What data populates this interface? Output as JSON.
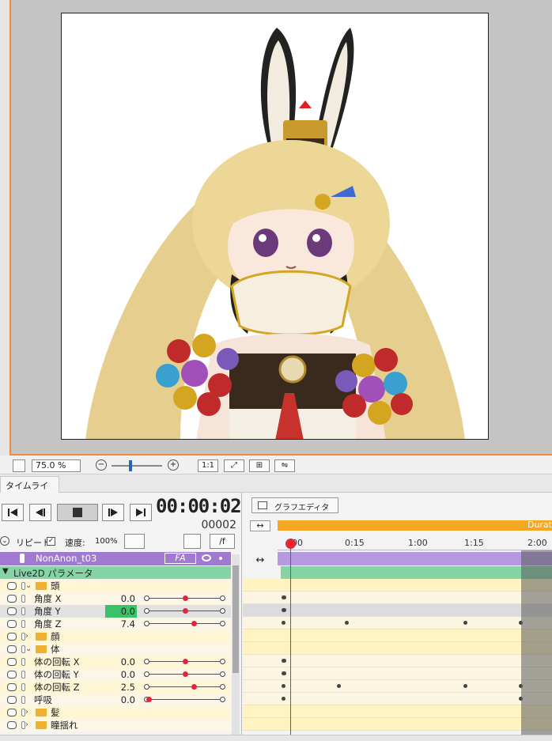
{
  "zoom": {
    "value": "75.0",
    "unit": "%",
    "ratio_button": "1:1"
  },
  "timeline": {
    "tab_label": "タイムライン",
    "timecode": "00:00:02",
    "frame": "00002",
    "repeat_label": "リピート",
    "speed_label": "速度:",
    "speed_value": "100%",
    "fps_button": "/f",
    "graph_editor_label": "グラフエディタ",
    "duration_label": "Durat",
    "ruler_ticks": [
      "00",
      "0:15",
      "1:00",
      "1:15",
      "2:00"
    ],
    "model_track": "NonAnon_t03",
    "model_badge": "FA",
    "param_group": "Live2D パラメータ",
    "rows": [
      {
        "kind": "folder",
        "label": "頭",
        "open": true
      },
      {
        "kind": "param",
        "label": "角度 X",
        "value": "0.0",
        "pos": 0.5
      },
      {
        "kind": "param",
        "label": "角度 Y",
        "value": "0.0",
        "pos": 0.5,
        "highlight": true
      },
      {
        "kind": "param",
        "label": "角度 Z",
        "value": "7.4",
        "pos": 0.62
      },
      {
        "kind": "folder",
        "label": "顔",
        "open": false
      },
      {
        "kind": "folder",
        "label": "体",
        "open": true
      },
      {
        "kind": "param",
        "label": "体の回転 X",
        "value": "0.0",
        "pos": 0.5
      },
      {
        "kind": "param",
        "label": "体の回転 Y",
        "value": "0.0",
        "pos": 0.5
      },
      {
        "kind": "param",
        "label": "体の回転 Z",
        "value": "2.5",
        "pos": 0.62
      },
      {
        "kind": "param",
        "label": "呼吸",
        "value": "0.0",
        "pos": 0.0
      },
      {
        "kind": "folder",
        "label": "髪",
        "open": false
      },
      {
        "kind": "folder",
        "label": "瞳揺れ",
        "open": false
      }
    ]
  },
  "colors": {
    "accent_orange": "#f08a3c",
    "duration_orange": "#f5a623",
    "model_purple": "#a07ad0",
    "param_green": "#86d3a6",
    "keyframe_red": "#e8243c"
  }
}
